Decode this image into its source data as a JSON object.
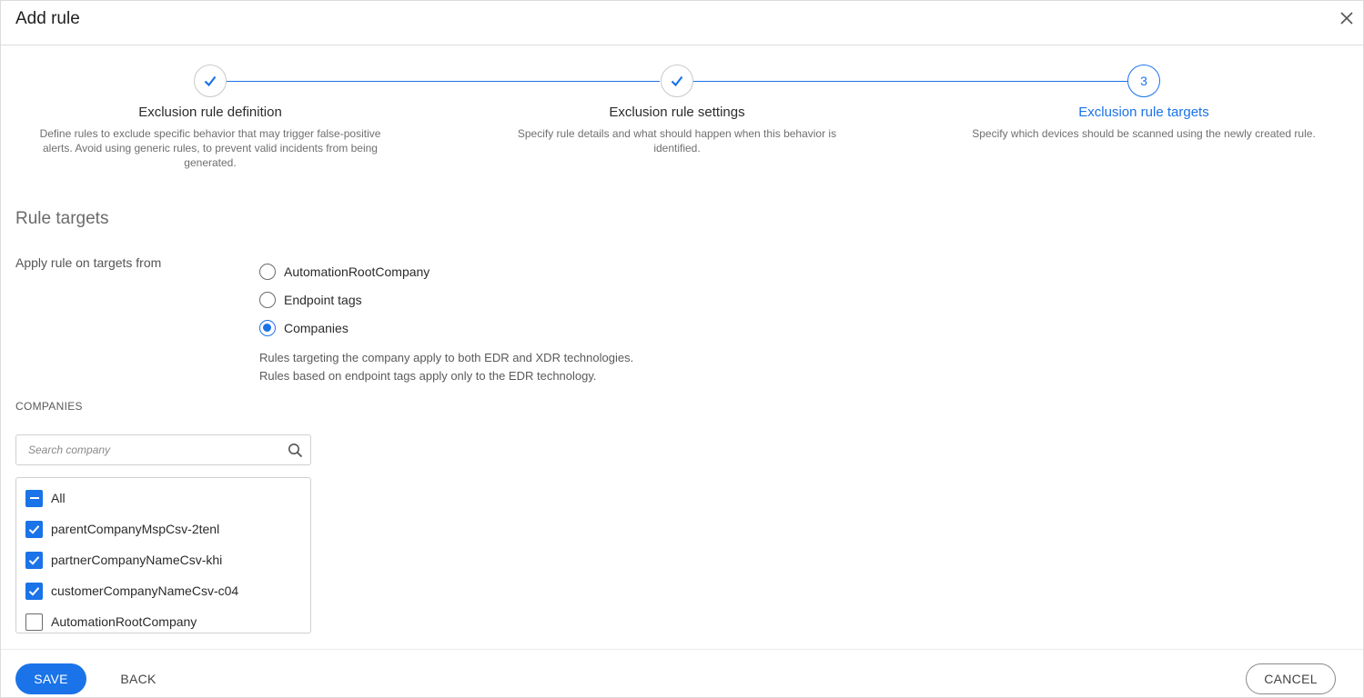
{
  "dialog": {
    "title": "Add rule",
    "close_icon": "close-icon"
  },
  "stepper": {
    "accent_color": "#1a73e8",
    "steps": [
      {
        "status": "completed",
        "icon": "check-icon",
        "title": "Exclusion rule definition",
        "description": "Define rules to exclude specific behavior that may trigger false-positive alerts. Avoid using generic rules, to prevent valid incidents from being generated."
      },
      {
        "status": "completed",
        "icon": "check-icon",
        "title": "Exclusion rule settings",
        "description": "Specify rule details and what should happen when this behavior is identified."
      },
      {
        "status": "active",
        "number": "3",
        "title": "Exclusion rule targets",
        "description": "Specify which devices should be scanned using the newly created rule."
      }
    ]
  },
  "rule_targets": {
    "section_title": "Rule targets",
    "apply_label": "Apply rule on targets from",
    "options": [
      {
        "label": "AutomationRootCompany",
        "selected": false
      },
      {
        "label": "Endpoint tags",
        "selected": false
      },
      {
        "label": "Companies",
        "selected": true
      }
    ],
    "hint_line1": "Rules targeting the company apply to both EDR and XDR technologies.",
    "hint_line2": "Rules based on endpoint tags apply only to the EDR technology."
  },
  "companies": {
    "label": "COMPANIES",
    "search_placeholder": "Search company",
    "search_value": "",
    "search_icon": "search-icon",
    "items": [
      {
        "label": "All",
        "state": "indeterminate"
      },
      {
        "label": "parentCompanyMspCsv-2tenl",
        "state": "checked"
      },
      {
        "label": "partnerCompanyNameCsv-khi",
        "state": "checked"
      },
      {
        "label": "customerCompanyNameCsv-c04",
        "state": "checked"
      },
      {
        "label": "AutomationRootCompany",
        "state": "unchecked"
      }
    ]
  },
  "footer": {
    "save_label": "SAVE",
    "back_label": "BACK",
    "cancel_label": "CANCEL"
  }
}
